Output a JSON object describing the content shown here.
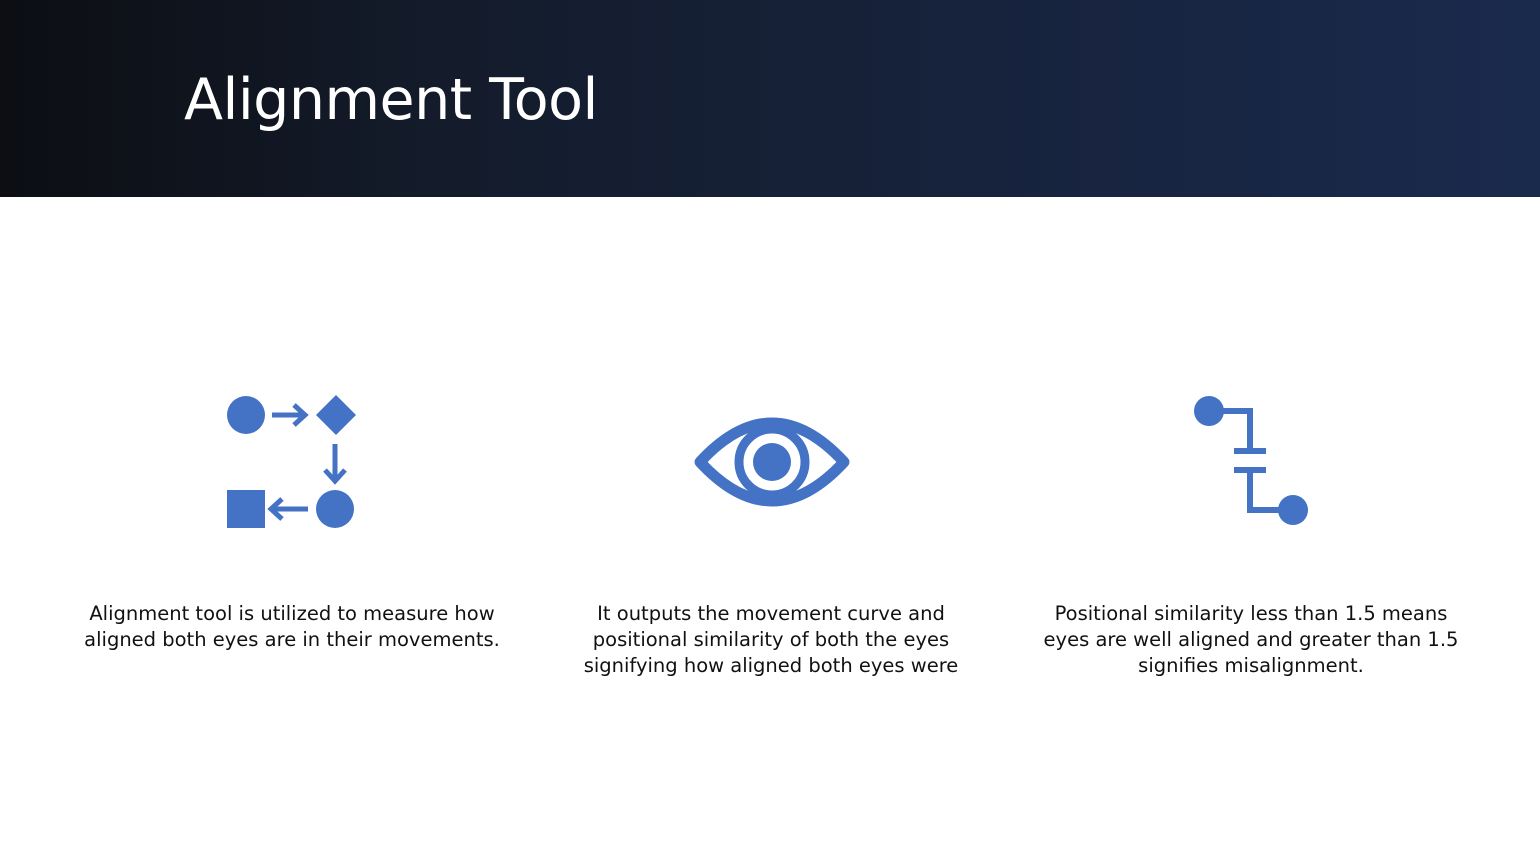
{
  "slide": {
    "title": "Alignment Tool",
    "accent_color": "#4472c4",
    "items": [
      {
        "icon": "process-flow-icon",
        "text": "Alignment tool is utilized to measure how aligned both eyes are in their movements."
      },
      {
        "icon": "eye-icon",
        "text": "It outputs the movement curve and positional similarity of both the eyes signifying how aligned both eyes were"
      },
      {
        "icon": "connector-path-icon",
        "text": "Positional similarity less than 1.5 means eyes are well aligned and greater than 1.5 signifies misalignment."
      }
    ]
  }
}
